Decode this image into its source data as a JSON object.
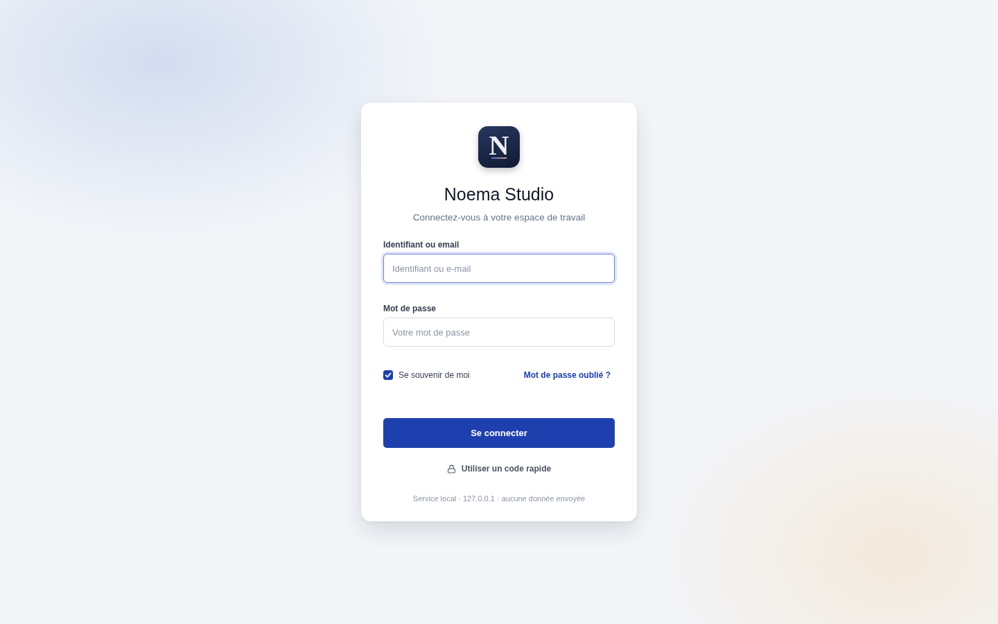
{
  "logo": {
    "letter": "N"
  },
  "title": "Noema Studio",
  "subtitle": "Connectez-vous à votre espace de travail",
  "fields": [
    {
      "label": "Identifiant ou email",
      "placeholder": "Identifiant ou e-mail",
      "focused": true
    },
    {
      "label": "Mot de passe",
      "placeholder": "Votre mot de passe",
      "focused": false
    }
  ],
  "remember": {
    "label": "Se souvenir de moi",
    "checked": true
  },
  "forgot_link": "Mot de passe oublié ?",
  "submit_button": "Se connecter",
  "quick_code_link": "Utiliser un code rapide",
  "footer": "Service local · 127.0.0.1 · aucune donnée envoyée"
}
